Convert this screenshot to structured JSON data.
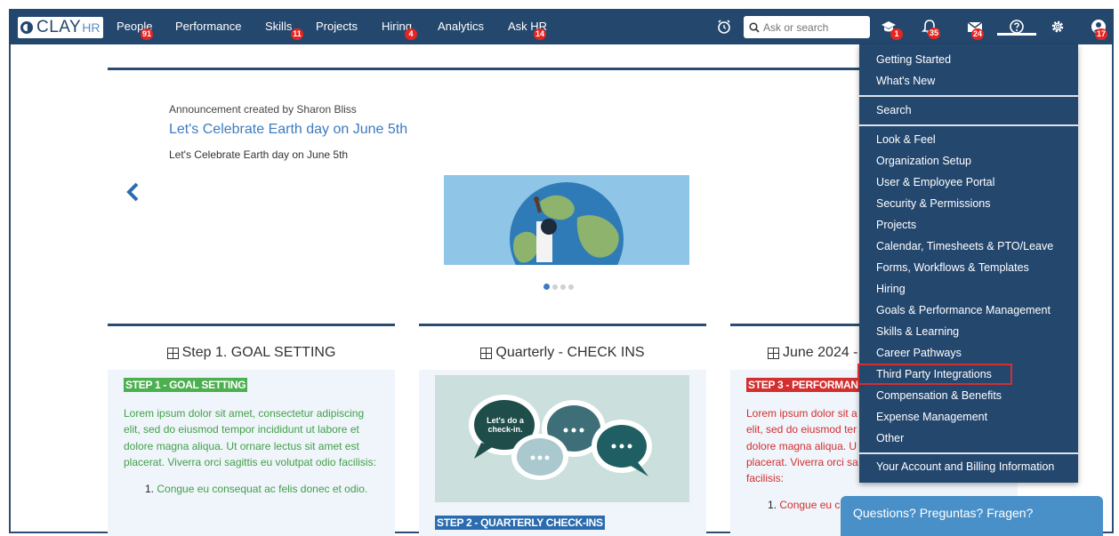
{
  "brand": {
    "logo_text": "CLAY",
    "logo_suffix": "HR"
  },
  "nav": {
    "items": [
      {
        "label": "People",
        "badge": "91"
      },
      {
        "label": "Performance",
        "badge": ""
      },
      {
        "label": "Skills",
        "badge": "11"
      },
      {
        "label": "Projects",
        "badge": ""
      },
      {
        "label": "Hiring",
        "badge": "4"
      },
      {
        "label": "Analytics",
        "badge": ""
      },
      {
        "label": "Ask HR",
        "badge": "14"
      }
    ],
    "search_placeholder": "Ask or search",
    "icons": [
      {
        "name": "alarm-clock-icon",
        "badge": ""
      },
      {
        "name": "graduation-cap-icon",
        "badge": "1"
      },
      {
        "name": "bell-icon",
        "badge": "35"
      },
      {
        "name": "mail-icon",
        "badge": "24"
      },
      {
        "name": "help-icon",
        "badge": ""
      },
      {
        "name": "gear-icon",
        "badge": ""
      },
      {
        "name": "user-avatar-icon",
        "badge": "17"
      }
    ]
  },
  "announcement": {
    "meta": "Announcement created by Sharon Bliss",
    "title": "Let's Celebrate Earth day on June 5th",
    "body": "Let's Celebrate Earth day on June 5th",
    "slides_total": 4,
    "active_slide": 1
  },
  "cards": [
    {
      "heading": "Step 1. GOAL SETTING",
      "tag": "STEP 1 - GOAL SETTING",
      "text": "Lorem ipsum dolor sit amet, consectetur adipiscing elit, sed do eiusmod tempor incididunt ut labore et dolore magna aliqua. Ut ornare lectus sit amet est placerat. Viverra orci sagittis eu volutpat odio facilisis:",
      "list_num": "1.",
      "list_text": "Congue eu consequat ac felis donec et odio."
    },
    {
      "heading": "Quarterly - CHECK INS",
      "tag": "STEP 2 - QUARTERLY CHECK-INS",
      "bubble_text": "Let's do a check-in."
    },
    {
      "heading": "June 2024 -",
      "tag": "STEP 3 - PERFORMAN",
      "text": "Lorem ipsum dolor sit a elit, sed do eiusmod ter dolore magna aliqua. U placerat. Viverra orci sa facilisis:",
      "list_num": "1.",
      "list_text": "Congue eu c"
    }
  ],
  "dropdown": {
    "items": [
      "Getting Started",
      "What's New",
      "Search",
      "Look & Feel",
      "Organization Setup",
      "User & Employee Portal",
      "Security & Permissions",
      "Projects",
      "Calendar, Timesheets & PTO/Leave",
      "Forms, Workflows & Templates",
      "Hiring",
      "Goals & Performance Management",
      "Skills & Learning",
      "Career Pathways",
      "Third Party Integrations",
      "Compensation & Benefits",
      "Expense Management",
      "Other",
      "Your Account and Billing Information"
    ],
    "highlighted": "Third Party Integrations"
  },
  "chat": {
    "label": "Questions? Preguntas? Fragen?"
  },
  "colors": {
    "nav_bg": "#24476e",
    "badge": "#e52520",
    "link": "#3d7bc1",
    "highlight_border": "#d32f2f"
  }
}
